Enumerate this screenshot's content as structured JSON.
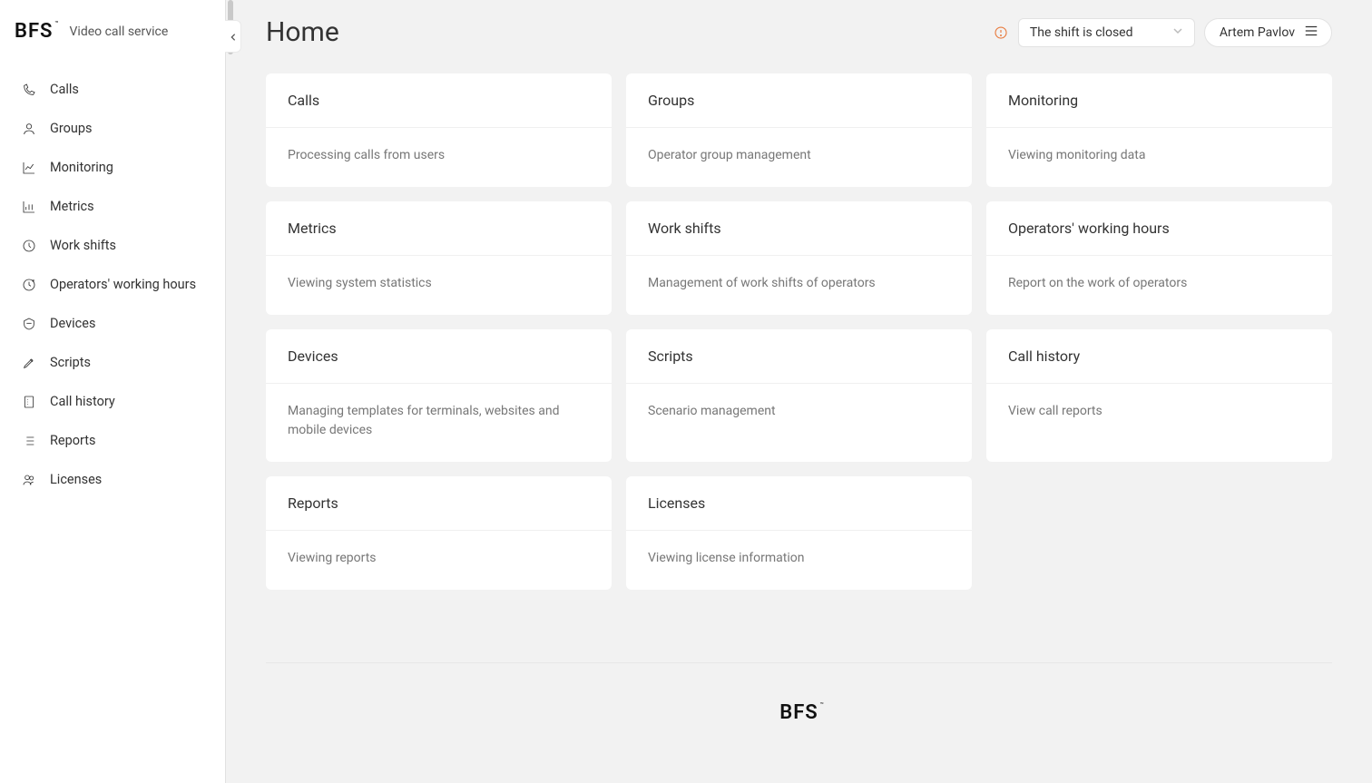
{
  "brand": {
    "logo": "BFS",
    "service": "Video call service"
  },
  "header": {
    "title": "Home",
    "shift_status": "The shift is closed",
    "user_name": "Artem Pavlov"
  },
  "sidebar": {
    "items": [
      {
        "label": "Calls",
        "icon": "phone-icon"
      },
      {
        "label": "Groups",
        "icon": "user-icon"
      },
      {
        "label": "Monitoring",
        "icon": "chart-line-icon"
      },
      {
        "label": "Metrics",
        "icon": "chart-bar-icon"
      },
      {
        "label": "Work shifts",
        "icon": "clock-icon"
      },
      {
        "label": "Operators' working hours",
        "icon": "clock-plus-icon"
      },
      {
        "label": "Devices",
        "icon": "terminal-icon"
      },
      {
        "label": "Scripts",
        "icon": "pen-icon"
      },
      {
        "label": "Call history",
        "icon": "page-icon"
      },
      {
        "label": "Reports",
        "icon": "list-icon"
      },
      {
        "label": "Licenses",
        "icon": "users-icon"
      }
    ]
  },
  "cards": [
    {
      "title": "Calls",
      "desc": "Processing calls from users"
    },
    {
      "title": "Groups",
      "desc": "Operator group management"
    },
    {
      "title": "Monitoring",
      "desc": "Viewing monitoring data"
    },
    {
      "title": "Metrics",
      "desc": "Viewing system statistics"
    },
    {
      "title": "Work shifts",
      "desc": "Management of work shifts of operators"
    },
    {
      "title": "Operators' working hours",
      "desc": "Report on the work of operators"
    },
    {
      "title": "Devices",
      "desc": "Managing templates for terminals, websites and mobile devices"
    },
    {
      "title": "Scripts",
      "desc": "Scenario management"
    },
    {
      "title": "Call history",
      "desc": "View call reports"
    },
    {
      "title": "Reports",
      "desc": "Viewing reports"
    },
    {
      "title": "Licenses",
      "desc": "Viewing license information"
    }
  ],
  "footer": {
    "logo": "BFS"
  }
}
